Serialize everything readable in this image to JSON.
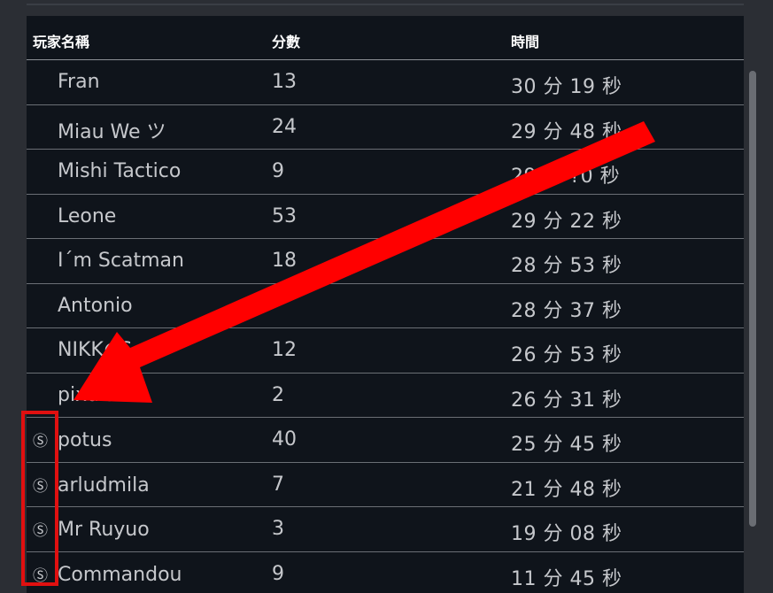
{
  "table": {
    "headers": {
      "player": "玩家名稱",
      "score": "分數",
      "time": "時間"
    },
    "rows": [
      {
        "badge": "",
        "name": "Fran",
        "score": "13",
        "time": "30 分 19 秒"
      },
      {
        "badge": "",
        "name": "Miau We ツ",
        "score": "24",
        "time": "29 分 48 秒"
      },
      {
        "badge": "",
        "name": "Mishi Tactico",
        "score": "9",
        "time": "29 分 ?0 秒"
      },
      {
        "badge": "",
        "name": "Leone",
        "score": "53",
        "time": "29 分 22 秒"
      },
      {
        "badge": "",
        "name": "I´m Scatman",
        "score": "18",
        "time": "28 分 53 秒"
      },
      {
        "badge": "",
        "name": "Antonio",
        "score": "",
        "time": "28 分 37 秒"
      },
      {
        "badge": "",
        "name": "NIKK⊕S",
        "score": "12",
        "time": "26 分 53 秒"
      },
      {
        "badge": "",
        "name": "pixula",
        "score": "2",
        "time": "26 分 31 秒"
      },
      {
        "badge": "Ⓢ",
        "name": "potus",
        "score": "40",
        "time": "25 分 45 秒"
      },
      {
        "badge": "Ⓢ",
        "name": "arludmila",
        "score": "7",
        "time": "21 分 48 秒"
      },
      {
        "badge": "Ⓢ",
        "name": "Mr Ruyuo",
        "score": "3",
        "time": "19 分 08 秒"
      },
      {
        "badge": "Ⓢ",
        "name": "Commandou",
        "score": "9",
        "time": "11 分 45 秒"
      }
    ]
  },
  "annotations": {
    "arrow_color": "#ff0000",
    "box_color": "#e01010"
  },
  "colors": {
    "panel_bg": "#0f141b",
    "page_bg": "#2b2e34",
    "text": "#c6c8cc",
    "header_text": "#ffffff"
  }
}
